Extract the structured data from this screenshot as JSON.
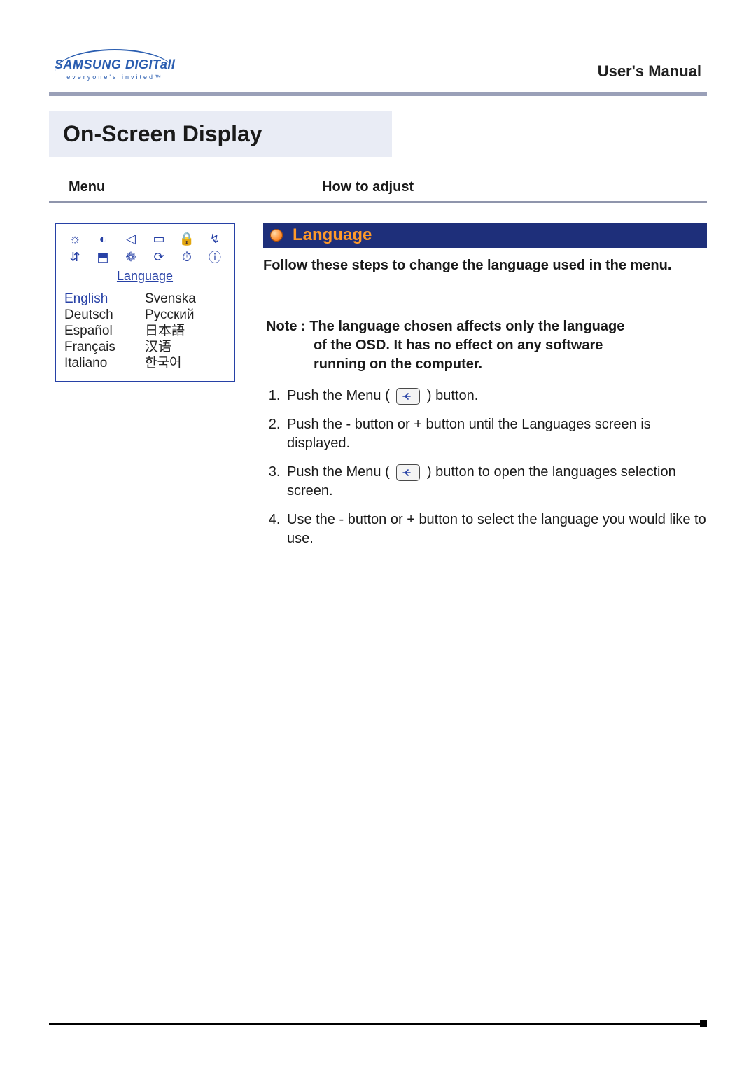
{
  "header": {
    "logo_main": "SAMSUNG DIGITall",
    "logo_tagline": "everyone's invited™",
    "manual_title": "User's Manual"
  },
  "page_title": "On-Screen Display",
  "column_headers": {
    "menu": "Menu",
    "how_to_adjust": "How to adjust"
  },
  "osd": {
    "label": "Language",
    "icons": [
      "brightness-icon",
      "contrast-icon",
      "h-position-icon",
      "h-size-icon",
      "lock-icon",
      "power-icon",
      "v-position-icon",
      "v-size-icon",
      "color-icon",
      "reset-icon",
      "timer-icon",
      "info-icon"
    ],
    "icon_glyphs": [
      "☼",
      "◐",
      "◁",
      "▭",
      "🔒",
      "↯",
      "⇵",
      "⬒",
      "❁",
      "⟳",
      "⏱",
      "ⓘ"
    ],
    "languages_left": [
      "English",
      "Deutsch",
      "Español",
      "Français",
      "Italiano"
    ],
    "languages_right": [
      "Svenska",
      "Русский",
      "日本語",
      "汉语",
      "한국어"
    ],
    "selected_language": "English"
  },
  "content": {
    "section_title": "Language",
    "intro": "Follow these steps to change the language used in the menu.",
    "note_prefix": "Note :",
    "note_line1": "The language chosen affects only the language",
    "note_line2": "of the OSD. It has no effect on any software",
    "note_line3": "running on the computer.",
    "steps": {
      "s1a": "Push the Menu (",
      "s1b": ") button.",
      "s2": "Push the - button or + button until the Languages screen is displayed.",
      "s3a": "Push the Menu (",
      "s3b": ") button to open the languages selection screen.",
      "s4": "Use the - button or + button to select the language you would like to use."
    }
  }
}
